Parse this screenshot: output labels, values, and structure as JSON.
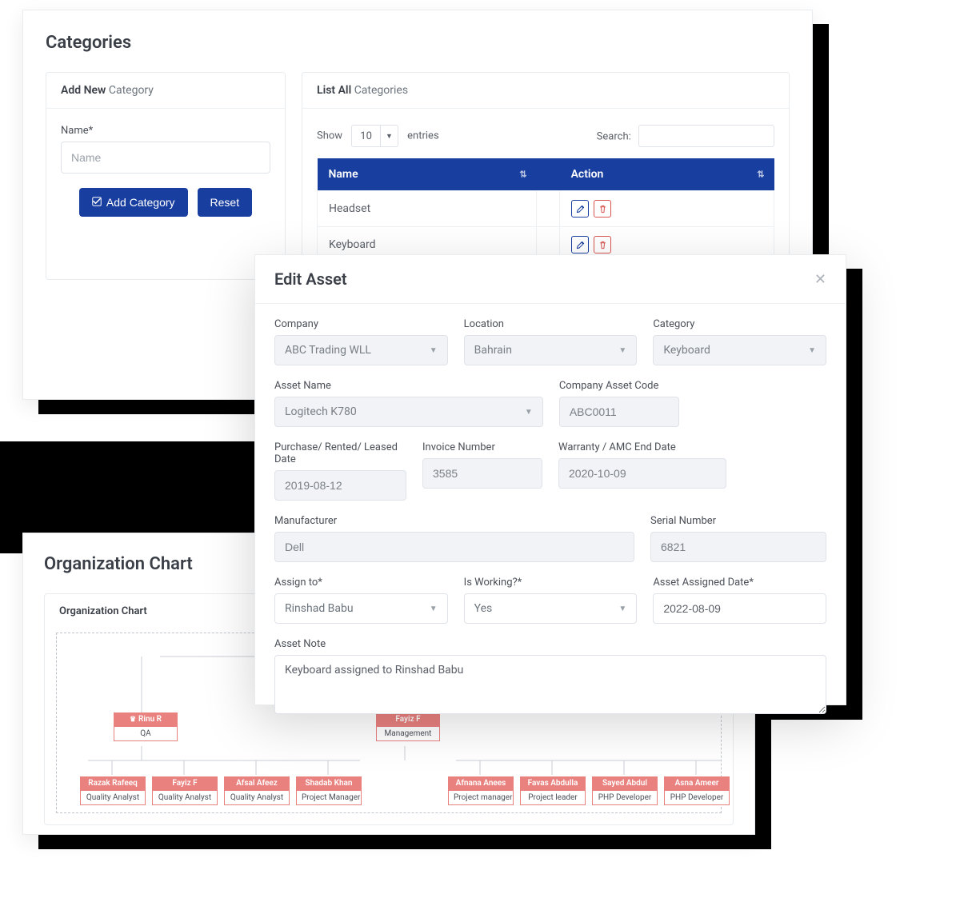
{
  "categories": {
    "title": "Categories",
    "add_new_card": {
      "bold": "Add New",
      "light": "Category"
    },
    "name_label": "Name*",
    "name_placeholder": "Name",
    "add_btn": "Add Category",
    "reset_btn": "Reset",
    "list_all_card": {
      "bold": "List All",
      "light": "Categories"
    },
    "show_label": "Show",
    "entries_value": "10",
    "entries_label": "entries",
    "search_label": "Search:",
    "th_name": "Name",
    "th_action": "Action",
    "rows": [
      {
        "name": "Headset"
      },
      {
        "name": "Keyboard"
      }
    ]
  },
  "edit_asset": {
    "title": "Edit Asset",
    "company_label": "Company",
    "company_value": "ABC Trading WLL",
    "location_label": "Location",
    "location_value": "Bahrain",
    "category_label": "Category",
    "category_value": "Keyboard",
    "asset_name_label": "Asset Name",
    "asset_name_value": "Logitech K780",
    "code_label": "Company Asset Code",
    "code_value": "ABC0011",
    "date_label": "Purchase/ Rented/ Leased Date",
    "date_value": "2019-08-12",
    "invoice_label": "Invoice Number",
    "invoice_value": "3585",
    "warranty_label": "Warranty / AMC End Date",
    "warranty_value": "2020-10-09",
    "manu_label": "Manufacturer",
    "manu_value": "Dell",
    "serial_label": "Serial Number",
    "serial_value": "6821",
    "assign_label": "Assign to*",
    "assign_value": "Rinshad Babu",
    "working_label": "Is Working?*",
    "working_value": "Yes",
    "assigned_date_label": "Asset Assigned Date*",
    "assigned_date_value": "2022-08-09",
    "note_label": "Asset Note",
    "note_value": "Keyboard assigned to Rinshad Babu"
  },
  "org": {
    "title": "Organization Chart",
    "inner_title": "Organization Chart",
    "managers": [
      {
        "name": "Rinu R",
        "role": "QA"
      },
      {
        "name": "Fayiz F",
        "role": "Management"
      }
    ],
    "reports_left": [
      {
        "name": "Razak Rafeeq",
        "role": "Quality Analyst"
      },
      {
        "name": "Fayiz F",
        "role": "Quality Analyst"
      },
      {
        "name": "Afsal Afeez",
        "role": "Quality Analyst"
      },
      {
        "name": "Shadab Khan",
        "role": "Project Manager"
      }
    ],
    "reports_right": [
      {
        "name": "Afnana Anees",
        "role": "Project manager"
      },
      {
        "name": "Favas Abdulla",
        "role": "Project leader"
      },
      {
        "name": "Sayed Abdul",
        "role": "PHP Developer"
      },
      {
        "name": "Asna Ameer",
        "role": "PHP Developer"
      }
    ]
  }
}
